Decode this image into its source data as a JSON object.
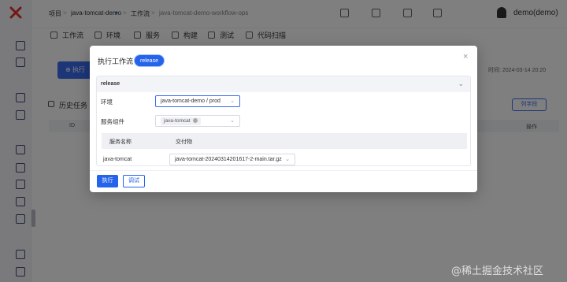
{
  "colors": {
    "primary": "#2563eb",
    "logo": "#e4322b"
  },
  "breadcrumb": {
    "project_label": "项目",
    "project_name": "java-tomcat-demo",
    "workflow_label": "工作流",
    "workflow_name": "java-tomcat-demo-workflow-ops"
  },
  "topbar": {
    "user": "demo(demo)"
  },
  "tabs": [
    {
      "label": "工作流",
      "icon": "workflow-icon"
    },
    {
      "label": "环境",
      "icon": "environment-icon"
    },
    {
      "label": "服务",
      "icon": "service-icon"
    },
    {
      "label": "构建",
      "icon": "build-icon"
    },
    {
      "label": "测试",
      "icon": "test-icon"
    },
    {
      "label": "代码扫描",
      "icon": "scan-icon"
    }
  ],
  "main": {
    "run_button": "执行",
    "history_title": "历史任务",
    "start_time": "时间: 2024-03-14 20:20",
    "field_sort": "列字段",
    "table_header": {
      "id": "ID",
      "ops": "操作"
    }
  },
  "modal": {
    "title": "执行工作流",
    "badge": "release",
    "close": "×",
    "panel_title": "release",
    "env_label": "环境",
    "env_value": "java-tomcat-demo / prod",
    "service_label": "服务组件",
    "service_tag": "java-tomcat",
    "table_headers": {
      "name": "服务名称",
      "artifact": "交付物"
    },
    "rows": [
      {
        "service": "java-tomcat",
        "artifact": "java-tomcat-20240314201617-2-main.tar.gz"
      }
    ],
    "run_button": "执行",
    "debug_button": "调试"
  },
  "watermark": "@稀土掘金技术社区"
}
